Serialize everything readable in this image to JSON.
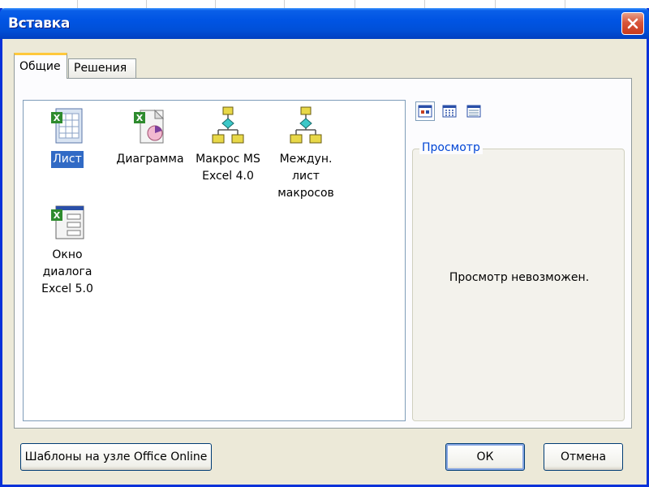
{
  "window": {
    "title": "Вставка"
  },
  "tabs": [
    {
      "label": "Общие",
      "active": true
    },
    {
      "label": "Решения",
      "active": false
    }
  ],
  "items": [
    {
      "label": "Лист",
      "icon": "worksheet-icon",
      "selected": true
    },
    {
      "label": "Диаграмма",
      "icon": "chart-sheet-icon",
      "selected": false
    },
    {
      "label": "Макрос MS\nExcel 4.0",
      "icon": "macro-sheet-icon",
      "selected": false
    },
    {
      "label": "Междун. лист\nмакросов",
      "icon": "international-macro-sheet-icon",
      "selected": false
    },
    {
      "label": "Окно диалога\nExcel 5.0",
      "icon": "dialog-sheet-icon",
      "selected": false
    }
  ],
  "view_buttons": [
    {
      "icon": "large-icons-view-icon",
      "active": true
    },
    {
      "icon": "list-view-icon",
      "active": false
    },
    {
      "icon": "details-view-icon",
      "active": false
    }
  ],
  "preview": {
    "legend": "Просмотр",
    "message": "Просмотр невозможен."
  },
  "buttons": {
    "templates": "Шаблоны на узле Office Online",
    "ok": "ОК",
    "cancel": "Отмена"
  },
  "colors": {
    "titlebar": "#0054e3",
    "selection": "#316ac5",
    "legend": "#0046d5",
    "close": "#d8553a"
  }
}
